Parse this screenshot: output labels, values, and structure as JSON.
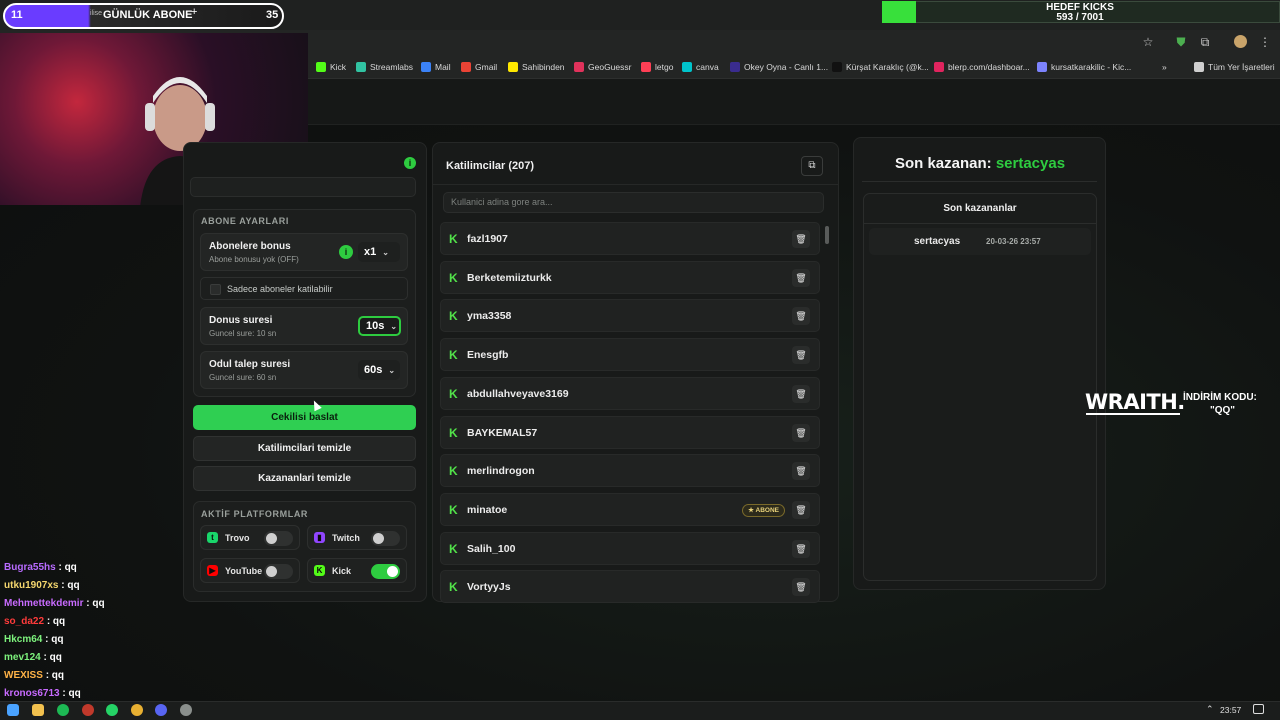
{
  "overlay": {
    "sub_goal": {
      "left_count": "11",
      "title": "GÜNLÜK ABONE",
      "right_count": "35",
      "plus": "+",
      "faint": "ilise"
    },
    "kick_goal": {
      "title": "HEDEF KICKS",
      "count": "593 / 7001",
      "progress": 0.0847
    }
  },
  "bookmarks": [
    {
      "label": "Kick",
      "color": "#53fc18"
    },
    {
      "label": "Streamlabs",
      "color": "#31c3a2"
    },
    {
      "label": "Mail",
      "color": "#3b82f6"
    },
    {
      "label": "Gmail",
      "color": "#ea4335"
    },
    {
      "label": "Sahibinden",
      "color": "#ffe800"
    },
    {
      "label": "GeoGuessr",
      "color": "#e0325b"
    },
    {
      "label": "letgo",
      "color": "#ff3f55"
    },
    {
      "label": "canva",
      "color": "#00c4cc"
    },
    {
      "label": "Okey Oyna - Canlı 1...",
      "color": "#3a2c8f"
    },
    {
      "label": "Kürşat Karaklıç (@k...",
      "color": "#111111"
    },
    {
      "label": "blerp.com/dashboar...",
      "color": "#e0245e"
    },
    {
      "label": "kursatkarakilic - Kic...",
      "color": "#7c83fd"
    },
    {
      "label": "Tüm Yer İşaretleri",
      "color": "#cfcfcf"
    }
  ],
  "left_panel": {
    "subscriber_section_title": "ABONE AYARLARI",
    "sub_bonus": {
      "name": "Abonelere bonus",
      "desc": "Abone bonusu yok (OFF)",
      "value": "x1",
      "info": "i"
    },
    "subs_only": "Sadece aboneler katilabilir",
    "bonus_time": {
      "name": "Donus suresi",
      "desc": "Guncel sure: 10 sn",
      "value": "10s"
    },
    "claim_time": {
      "name": "Odul talep suresi",
      "desc": "Guncel sure: 60 sn",
      "value": "60s"
    },
    "btn_start": "Cekilisi baslat",
    "btn_clear_participants": "Katilimcilari temizle",
    "btn_clear_winners": "Kazananlari temizle",
    "platforms_title": "AKTİF PLATFORMLAR",
    "platforms": [
      {
        "name": "Trovo",
        "on": false,
        "color": "#19d66b",
        "glyph": "t"
      },
      {
        "name": "Twitch",
        "on": false,
        "color": "#9146ff",
        "glyph": "▮"
      },
      {
        "name": "YouTube",
        "on": false,
        "color": "#ff0000",
        "glyph": "▶"
      },
      {
        "name": "Kick",
        "on": true,
        "color": "#53fc18",
        "glyph": "K"
      }
    ],
    "header_info": "i"
  },
  "participants": {
    "title": "Katilimcilar (207)",
    "search_placeholder": "Kullanici adina gore ara...",
    "badge_label": "★ ABONE",
    "list": [
      {
        "name": "fazl1907",
        "badge": false
      },
      {
        "name": "Berketemiizturkk",
        "badge": false
      },
      {
        "name": "yma3358",
        "badge": false
      },
      {
        "name": "Enesgfb",
        "badge": false
      },
      {
        "name": "abdullahveyave3169",
        "badge": false
      },
      {
        "name": "BAYKEMAL57",
        "badge": false
      },
      {
        "name": "merlindrogon",
        "badge": false
      },
      {
        "name": "minatoe",
        "badge": true
      },
      {
        "name": "Salih_100",
        "badge": false
      },
      {
        "name": "VortyyJs",
        "badge": false
      }
    ]
  },
  "winners": {
    "title_prefix": "Son kazanan:",
    "title_name": "sertacyas",
    "list_title": "Son kazananlar",
    "rows": [
      {
        "name": "sertacyas",
        "date": "20-03-26 23:57"
      }
    ]
  },
  "sponsor": {
    "brand": "WRAITH.",
    "line1": "İNDİRİM KODU:",
    "line2": "\"QQ\""
  },
  "chat": [
    {
      "user": "Bugra55hs",
      "msg": ": qq",
      "color": "#b86bff"
    },
    {
      "user": "utku1907xs",
      "msg": ": qq",
      "color": "#f5d76e"
    },
    {
      "user": "Mehmettekdemir",
      "msg": ": qq",
      "color": "#c86bff"
    },
    {
      "user": "so_da22",
      "msg": ": qq",
      "color": "#ff3b3b"
    },
    {
      "user": "Hkcm64",
      "msg": ": qq",
      "color": "#7df27d"
    },
    {
      "user": "mev124",
      "msg": ": qq",
      "color": "#7df27d"
    },
    {
      "user": "WEXISS",
      "msg": ": qq",
      "color": "#ffb347"
    },
    {
      "user": "kronos6713",
      "msg": ": qq",
      "color": "#c86bff"
    }
  ],
  "taskbar": {
    "clock": "23:57"
  }
}
